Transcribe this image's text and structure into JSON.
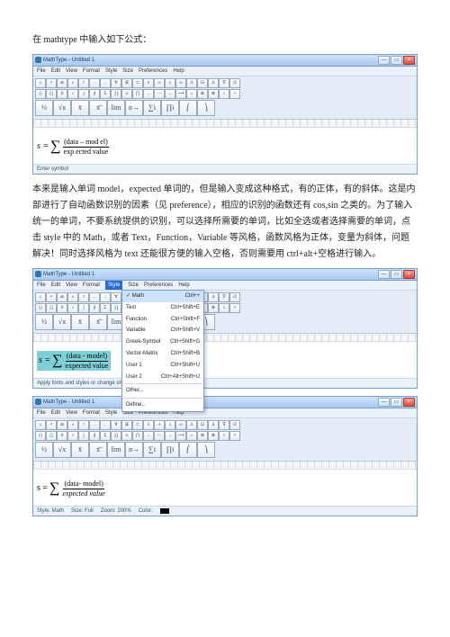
{
  "intro": "在 mathtype 中输入如下公式：",
  "para1": "本来是输入单词 model，expected 单词的，但是输入变成这种格式，有的正体，有的斜体。这是内部进行了自动函数识别的因素（见 preference），相应的识别的函数还有 cos,sin 之类的。为了输入统一的单词，不要系统提供的识别，可以选择所需要的单词，比如全选或者选择需要的单词，点击 style 中的 Math，或者 Text，Function，Variable 等风格，函数风格为正体，变量为斜体，问题解决！同时选择风格为 text 还能很方便的输入空格，否则需要用 ctrl+alt+空格进行输入。",
  "app": {
    "title": "MathType - Untitled 1",
    "menus": [
      "File",
      "Edit",
      "View",
      "Format",
      "Style",
      "Size",
      "Preferences",
      "Help"
    ],
    "win_min": "—",
    "win_max": "▭",
    "win_close": "×"
  },
  "tool_r1": [
    "≤",
    "≠",
    "ab",
    "±",
    "×",
    "→",
    "∴",
    "∀",
    "∉",
    "⊂",
    "∂",
    "∞",
    "λ",
    "ω",
    "Λ",
    "Ω",
    "Δ",
    "∇",
    "∅"
  ],
  "tool_r2": [
    "()",
    "[]",
    "‖‖",
    "√",
    "∫",
    "∮",
    "Σ",
    "∏",
    "∪",
    "⋂",
    "→",
    "—",
    "↔",
    "⟶",
    "⇔",
    "⊕",
    "⊗",
    "≡",
    "≈"
  ],
  "tool_r3": [
    "½",
    "√x",
    "x̄",
    "x͞",
    "lim",
    "n→",
    "∑i",
    "∏i",
    "⎛",
    "⎞"
  ],
  "eq1": {
    "prefix": "s =",
    "top": "(data – mod el)",
    "bot": "exp ected value"
  },
  "dropdown": {
    "items": [
      {
        "l": "Math",
        "r": "Ctrl++"
      },
      {
        "l": "Text",
        "r": "Ctrl+Shift+E"
      },
      {
        "l": "Function",
        "r": "Ctrl+Shift+F"
      },
      {
        "l": "Variable",
        "r": "Ctrl+Shift+V"
      },
      {
        "l": "Greek-Symbol",
        "r": "Ctrl+Shift+G"
      },
      {
        "l": "Vector-Matrix",
        "r": "Ctrl+Shift+B"
      },
      {
        "l": "User 1",
        "r": "Ctrl+Shift+U"
      },
      {
        "l": "User 2",
        "r": "Ctrl+Alt+Shift+U"
      },
      {
        "l": "Other...",
        "r": ""
      },
      {
        "l": "Define...",
        "r": ""
      }
    ]
  },
  "eq2": {
    "prefix": "s =",
    "top": "(data - model)",
    "bot": "expected value"
  },
  "status1": "Enter symbol",
  "status2": "Apply fonts and styles or change style definitions",
  "status3_items": [
    "Style: Math",
    "Size: Full",
    "Zoom: 200%",
    "Color:"
  ],
  "eq3": {
    "prefix": "s =",
    "top": "(data- model)",
    "bot": "expected value"
  }
}
